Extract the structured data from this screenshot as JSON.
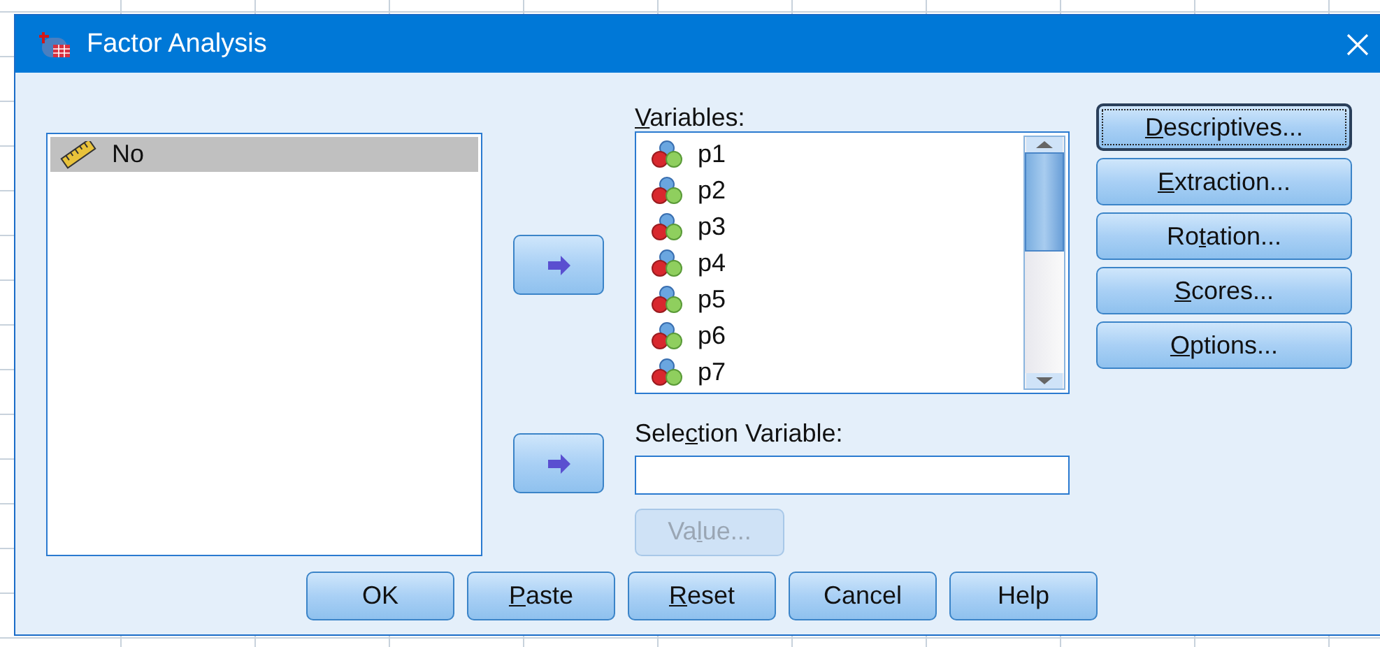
{
  "window": {
    "title": "Factor Analysis"
  },
  "source_list": {
    "items": [
      {
        "name": "No",
        "kind": "scale",
        "selected": true
      }
    ]
  },
  "move_buttons": [
    {
      "disabled": false
    },
    {
      "disabled": false
    }
  ],
  "variables": {
    "label": {
      "key": "V",
      "after": "ariables:"
    },
    "items": [
      {
        "name": "p1",
        "kind": "nominal",
        "selected": false
      },
      {
        "name": "p2",
        "kind": "nominal",
        "selected": false
      },
      {
        "name": "p3",
        "kind": "nominal",
        "selected": false
      },
      {
        "name": "p4",
        "kind": "nominal",
        "selected": false
      },
      {
        "name": "p5",
        "kind": "nominal",
        "selected": false
      },
      {
        "name": "p6",
        "kind": "nominal",
        "selected": false
      },
      {
        "name": "p7",
        "kind": "nominal",
        "selected": false
      }
    ]
  },
  "selection_variable": {
    "label": {
      "before": "Sele",
      "key": "c",
      "after": "tion Variable:"
    },
    "value_button": {
      "label": {
        "before": "Va",
        "key": "l",
        "after": "ue..."
      },
      "disabled": true
    }
  },
  "side_buttons": [
    {
      "label": {
        "key": "D",
        "after": "escriptives..."
      },
      "default": true
    },
    {
      "label": {
        "key": "E",
        "after": "xtraction..."
      },
      "default": false
    },
    {
      "label": {
        "before": "Ro",
        "key": "t",
        "after": "ation..."
      },
      "default": false
    },
    {
      "label": {
        "key": "S",
        "after": "cores..."
      },
      "default": false
    },
    {
      "label": {
        "key": "O",
        "after": "ptions..."
      },
      "default": false
    }
  ],
  "bottom_buttons": [
    {
      "label": {
        "before": "OK"
      }
    },
    {
      "label": {
        "key": "P",
        "after": "aste"
      }
    },
    {
      "label": {
        "key": "R",
        "after": "eset"
      }
    },
    {
      "label": {
        "before": "Cancel"
      }
    },
    {
      "label": {
        "before": "Help"
      }
    }
  ]
}
